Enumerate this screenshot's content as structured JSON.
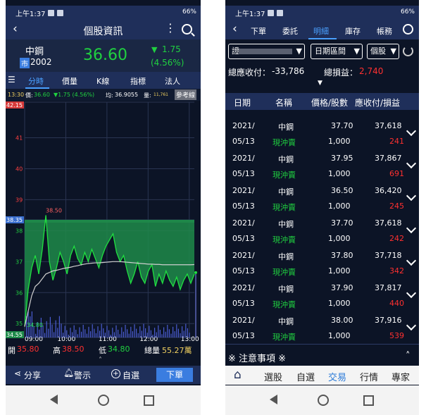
{
  "status": {
    "time": "上午1:37",
    "battery": "66%"
  },
  "left": {
    "header": {
      "title": "個股資訊"
    },
    "stock": {
      "name": "中鋼",
      "market_badge": "市",
      "code": "2002",
      "price": "36.60",
      "change": "1.75",
      "change_pct": "(4.56%)"
    },
    "tabs": [
      "分時",
      "價量",
      "K線",
      "指標",
      "法人"
    ],
    "info_bar": {
      "time": "13:30",
      "price_label": "價:",
      "price": "36.60",
      "change": "1.75 (4.56%)",
      "avg_label": "均:",
      "avg": "36.9055",
      "vol_label": "量:",
      "vol": "11,761",
      "ref_button": "參考線"
    },
    "chart_data": {
      "type": "line",
      "y_ticks": [
        "42.15",
        "41",
        "40",
        "39",
        "38.35",
        "38",
        "37",
        "36",
        "35",
        "34.55"
      ],
      "x_ticks": [
        "09:00",
        "10:00",
        "11:00",
        "12:00",
        "13:00"
      ],
      "ylim": [
        34.55,
        42.15
      ],
      "reference": 38.35,
      "annot_high": "38.50",
      "annot_low": "34.80",
      "price_series": [
        34.9,
        36.1,
        36.8,
        37.2,
        36.6,
        37.4,
        38.5,
        37.0,
        36.4,
        36.8,
        37.3,
        37.0,
        36.6,
        37.2,
        37.5,
        37.1,
        36.9,
        37.3,
        37.0,
        37.4,
        37.1,
        36.8,
        37.2,
        37.5,
        37.7,
        37.9,
        37.3,
        37.0,
        37.2,
        36.7,
        36.3,
        36.6,
        37.0,
        36.5,
        36.3,
        36.7,
        36.9,
        36.2,
        36.6,
        36.3,
        36.7,
        36.4,
        36.2,
        36.5,
        36.1,
        36.4,
        36.6,
        36.3,
        36.6
      ],
      "avg_series": [
        34.9,
        35.4,
        35.9,
        36.2,
        36.3,
        36.45,
        36.6,
        36.65,
        36.7,
        36.72,
        36.75,
        36.78,
        36.8,
        36.82,
        36.85,
        36.87,
        36.9,
        36.92,
        36.94,
        36.95,
        36.96,
        36.96,
        36.97,
        36.98,
        36.99,
        37.0,
        37.0,
        37.0,
        36.99,
        36.98,
        36.97,
        36.96,
        36.95,
        36.94,
        36.93,
        36.92,
        36.92,
        36.91,
        36.91,
        36.9,
        36.9,
        36.9,
        36.9,
        36.9,
        36.9,
        36.9,
        36.9,
        36.9,
        36.9055
      ]
    },
    "ohlc": {
      "open_label": "開",
      "open": "35.80",
      "high_label": "高",
      "high": "38.50",
      "low_label": "低",
      "low": "34.80",
      "vol_label": "總量",
      "vol": "55.27萬"
    },
    "bottom": {
      "share": "分享",
      "alert": "警示",
      "watch": "自選",
      "order": "下單"
    }
  },
  "right": {
    "tabs": [
      "下單",
      "委託",
      "明細",
      "庫存",
      "帳務"
    ],
    "filters": {
      "account": "證",
      "date_range": "日期區間",
      "type": "個股"
    },
    "summary": {
      "total_receivable_label": "總應收付：",
      "total_receivable": "-33,786",
      "total_pl_label": "總損益：",
      "total_pl": "2,740"
    },
    "columns": [
      "日期",
      "名稱",
      "價格/股數",
      "應收付/損益"
    ],
    "rows": [
      {
        "date1": "2021/",
        "date2": "05/13",
        "name": "中鋼",
        "kind": "現沖賣",
        "price": "37.70",
        "shares": "1,000",
        "amount": "37,618",
        "pl": "241"
      },
      {
        "date1": "2021/",
        "date2": "05/13",
        "name": "中鋼",
        "kind": "現沖賣",
        "price": "37.95",
        "shares": "1,000",
        "amount": "37,867",
        "pl": "691"
      },
      {
        "date1": "2021/",
        "date2": "05/13",
        "name": "中鋼",
        "kind": "現沖賣",
        "price": "36.50",
        "shares": "1,000",
        "amount": "36,420",
        "pl": "245"
      },
      {
        "date1": "2021/",
        "date2": "05/13",
        "name": "中鋼",
        "kind": "現沖賣",
        "price": "37.70",
        "shares": "1,000",
        "amount": "37,618",
        "pl": "242"
      },
      {
        "date1": "2021/",
        "date2": "05/13",
        "name": "中鋼",
        "kind": "現沖賣",
        "price": "37.80",
        "shares": "1,000",
        "amount": "37,718",
        "pl": "342"
      },
      {
        "date1": "2021/",
        "date2": "05/13",
        "name": "中鋼",
        "kind": "現沖賣",
        "price": "37.90",
        "shares": "1,000",
        "amount": "37,817",
        "pl": "440"
      },
      {
        "date1": "2021/",
        "date2": "05/13",
        "name": "中鋼",
        "kind": "現沖賣",
        "price": "38.00",
        "shares": "1,000",
        "amount": "37,916",
        "pl": "539"
      }
    ],
    "notice": "※ 注意事項 ※",
    "bottom_tabs": [
      "選股",
      "自選",
      "交易",
      "行情",
      "專家"
    ]
  },
  "colors": {
    "navy": "#1f2f5a",
    "dark_bg": "#0c1426",
    "up": "#ff3030",
    "down": "#20d040",
    "area": "#1e8a4a",
    "accent_blue": "#3a7de0"
  }
}
